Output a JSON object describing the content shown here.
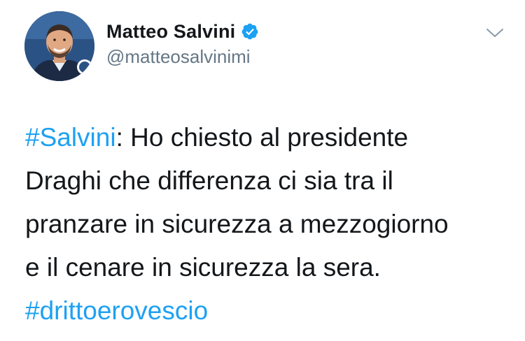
{
  "author": {
    "display_name": "Matteo Salvini",
    "handle": "@matteosalvinimi",
    "verified": true
  },
  "icons": {
    "verified": "verified-badge-icon",
    "menu": "chevron-down-icon"
  },
  "colors": {
    "hashtag": "#1da1f2",
    "text": "#14171a",
    "handle": "#657786",
    "verified_badge": "#1da1f2"
  },
  "tweet": {
    "hashtag_start": "#Salvini",
    "line1_rest": ": Ho chiesto al presidente",
    "line2": "Draghi che differenza ci sia tra il",
    "line3": "pranzare in sicurezza a mezzogiorno",
    "line4": "e il cenare in sicurezza la sera.",
    "hashtag_end": "#drittoerovescio"
  }
}
